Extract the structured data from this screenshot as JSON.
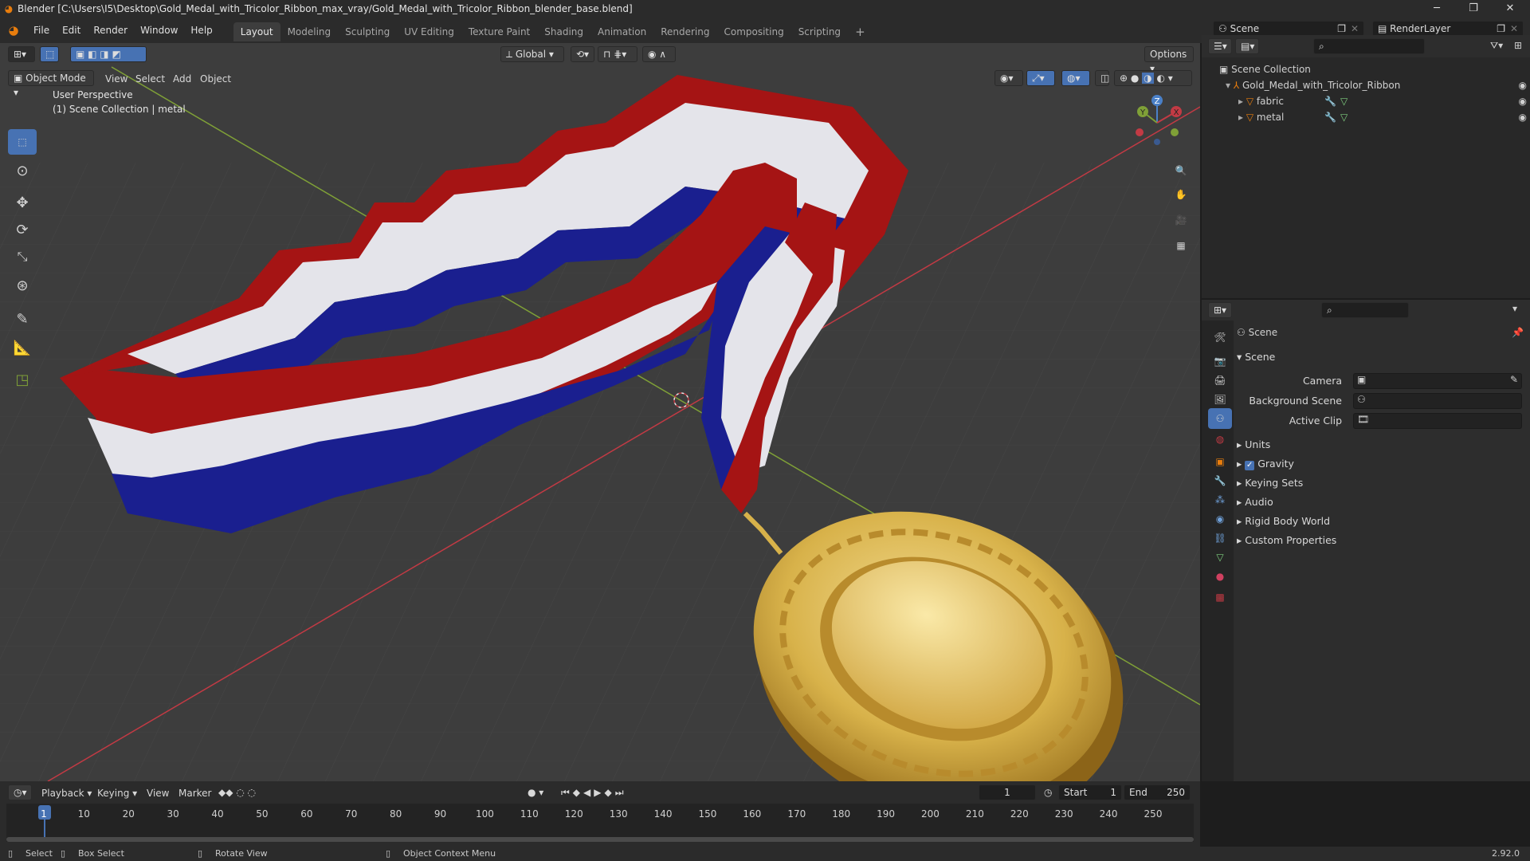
{
  "window": {
    "title": "Blender [C:\\Users\\I5\\Desktop\\Gold_Medal_with_Tricolor_Ribbon_max_vray/Gold_Medal_with_Tricolor_Ribbon_blender_base.blend]"
  },
  "menu": [
    "File",
    "Edit",
    "Render",
    "Window",
    "Help"
  ],
  "workspaces": [
    "Layout",
    "Modeling",
    "Sculpting",
    "UV Editing",
    "Texture Paint",
    "Shading",
    "Animation",
    "Rendering",
    "Compositing",
    "Scripting"
  ],
  "scene_name": "Scene",
  "view_layer": "RenderLayer",
  "viewport": {
    "mode": "Object Mode",
    "menus": [
      "View",
      "Select",
      "Add",
      "Object"
    ],
    "transform_orientation": "Global",
    "options_label": "Options",
    "info_line1": "User Perspective",
    "info_line2": "(1) Scene Collection | metal",
    "gizmo": {
      "x": "X",
      "y": "Y",
      "z": "Z"
    }
  },
  "outliner": {
    "root": "Scene Collection",
    "items": [
      {
        "label": "Gold_Medal_with_Tricolor_Ribbon",
        "level": 1
      },
      {
        "label": "fabric",
        "level": 2
      },
      {
        "label": "metal",
        "level": 2
      }
    ]
  },
  "properties": {
    "header": "Scene",
    "panel": "Scene",
    "fields": [
      {
        "label": "Camera"
      },
      {
        "label": "Background Scene"
      },
      {
        "label": "Active Clip"
      }
    ],
    "sections": [
      "Units",
      "Gravity",
      "Keying Sets",
      "Audio",
      "Rigid Body World",
      "Custom Properties"
    ],
    "gravity_checked": true
  },
  "timeline": {
    "menus": [
      "Playback",
      "Keying",
      "View",
      "Marker"
    ],
    "current_frame": "1",
    "start_label": "Start",
    "start": "1",
    "end_label": "End",
    "end": "250",
    "ticks": [
      "1",
      "10",
      "20",
      "30",
      "40",
      "50",
      "60",
      "70",
      "80",
      "90",
      "100",
      "110",
      "120",
      "130",
      "140",
      "150",
      "160",
      "170",
      "180",
      "190",
      "200",
      "210",
      "220",
      "230",
      "240",
      "250"
    ]
  },
  "status": {
    "select": "Select",
    "box_select": "Box Select",
    "rotate": "Rotate View",
    "context": "Object Context Menu",
    "version": "2.92.0"
  },
  "colors": {
    "accent": "#4772b3",
    "active_tab": "#3d3d3d",
    "gold": "#d8b24a",
    "ribbon_red": "#a51414",
    "ribbon_blue": "#1a1f8f",
    "grid_x": "#c23a44",
    "grid_y": "#7fa037"
  }
}
